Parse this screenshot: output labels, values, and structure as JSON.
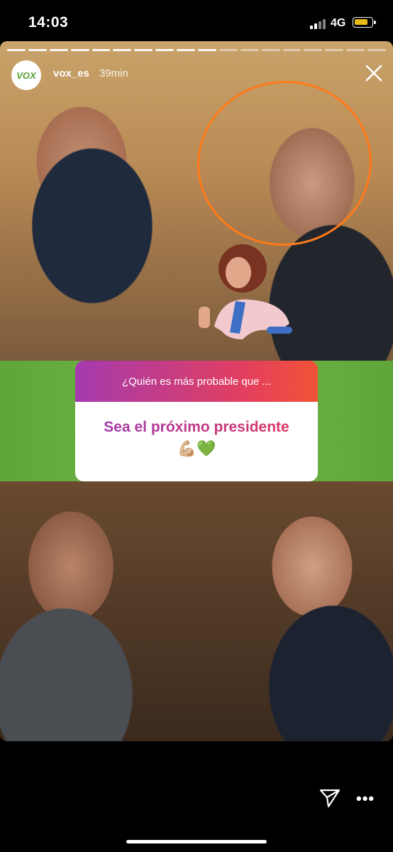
{
  "status_bar": {
    "time": "14:03",
    "network": "4G",
    "battery_color": "#f5c518"
  },
  "story": {
    "username": "vox_es",
    "time_ago": "39min",
    "avatar_logo": "VOX",
    "progress_segments_total": 18,
    "progress_segments_done": 10
  },
  "poll": {
    "header": "¿Quién es más probable que ...",
    "question": "Sea el próximo presidente",
    "emoji": "💪🏼💚"
  },
  "icons": {
    "close": "close-icon",
    "send": "send-icon",
    "more": "more-options-icon"
  },
  "colors": {
    "accent_orange": "#ff7a1a",
    "band_green": "#6ab13f",
    "poll_gradient_start": "#a43aae",
    "poll_gradient_end": "#f05335"
  }
}
